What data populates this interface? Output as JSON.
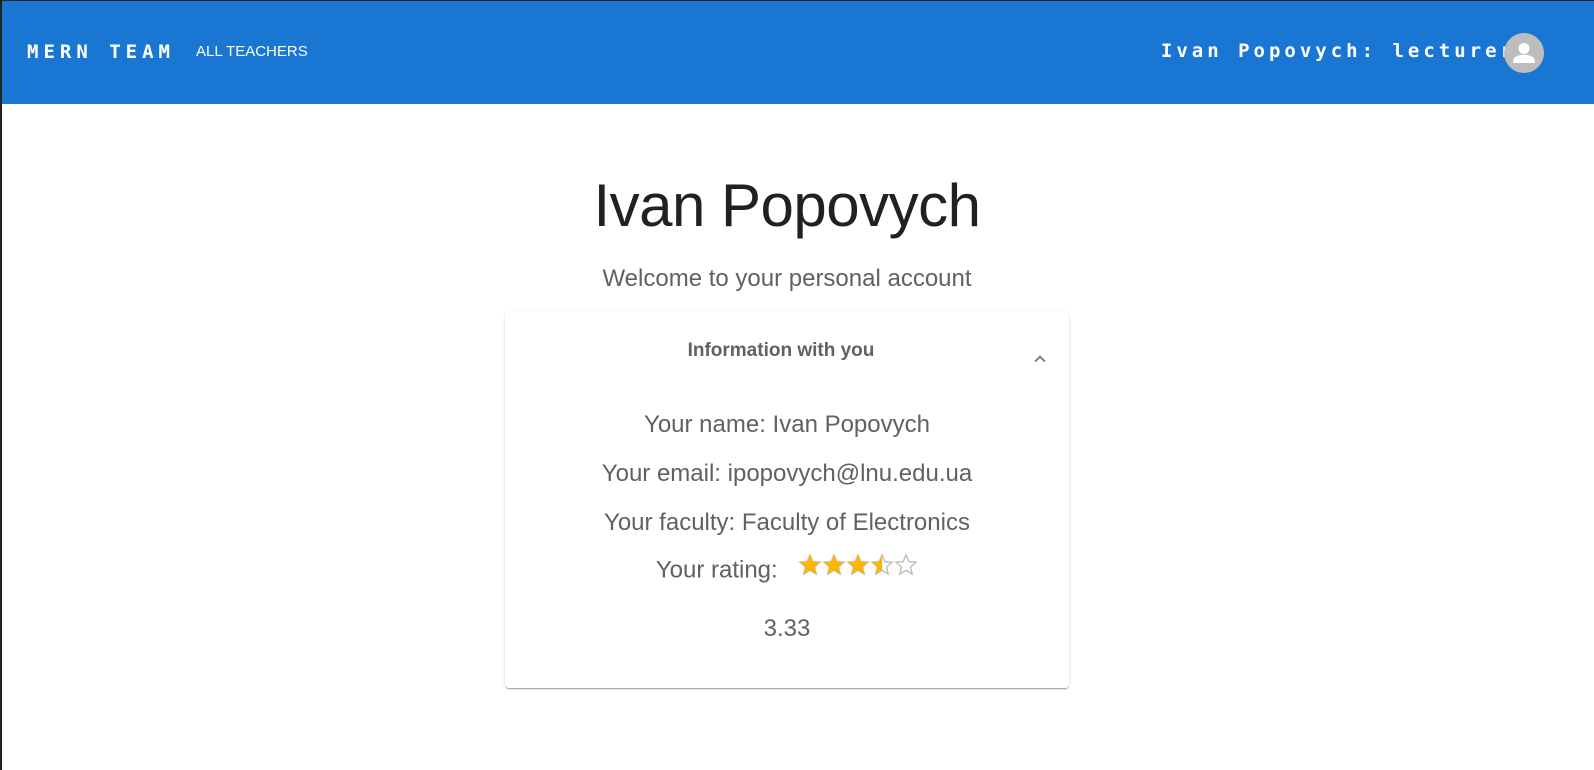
{
  "header": {
    "logo": "MERN TEAM",
    "nav_link": "ALL TEACHERS",
    "user_label": "Ivan Popovych: lecturer",
    "avatar_icon": "person-icon",
    "bar_color": "#1976d2"
  },
  "main": {
    "title": "Ivan Popovych",
    "subtitle": "Welcome to your personal account"
  },
  "card": {
    "header_title": "Information with you",
    "expand_icon": "chevron-up-icon",
    "name_line": "Your name: Ivan Popovych",
    "email_line": "Your email: ipopovych@lnu.edu.ua",
    "faculty_line": "Your faculty: Faculty of Electronics",
    "rating_label": "Your rating:",
    "rating_value": "3.33",
    "rating_stars": 3.33,
    "rating_max": 5,
    "star_color": "#ffb400"
  }
}
